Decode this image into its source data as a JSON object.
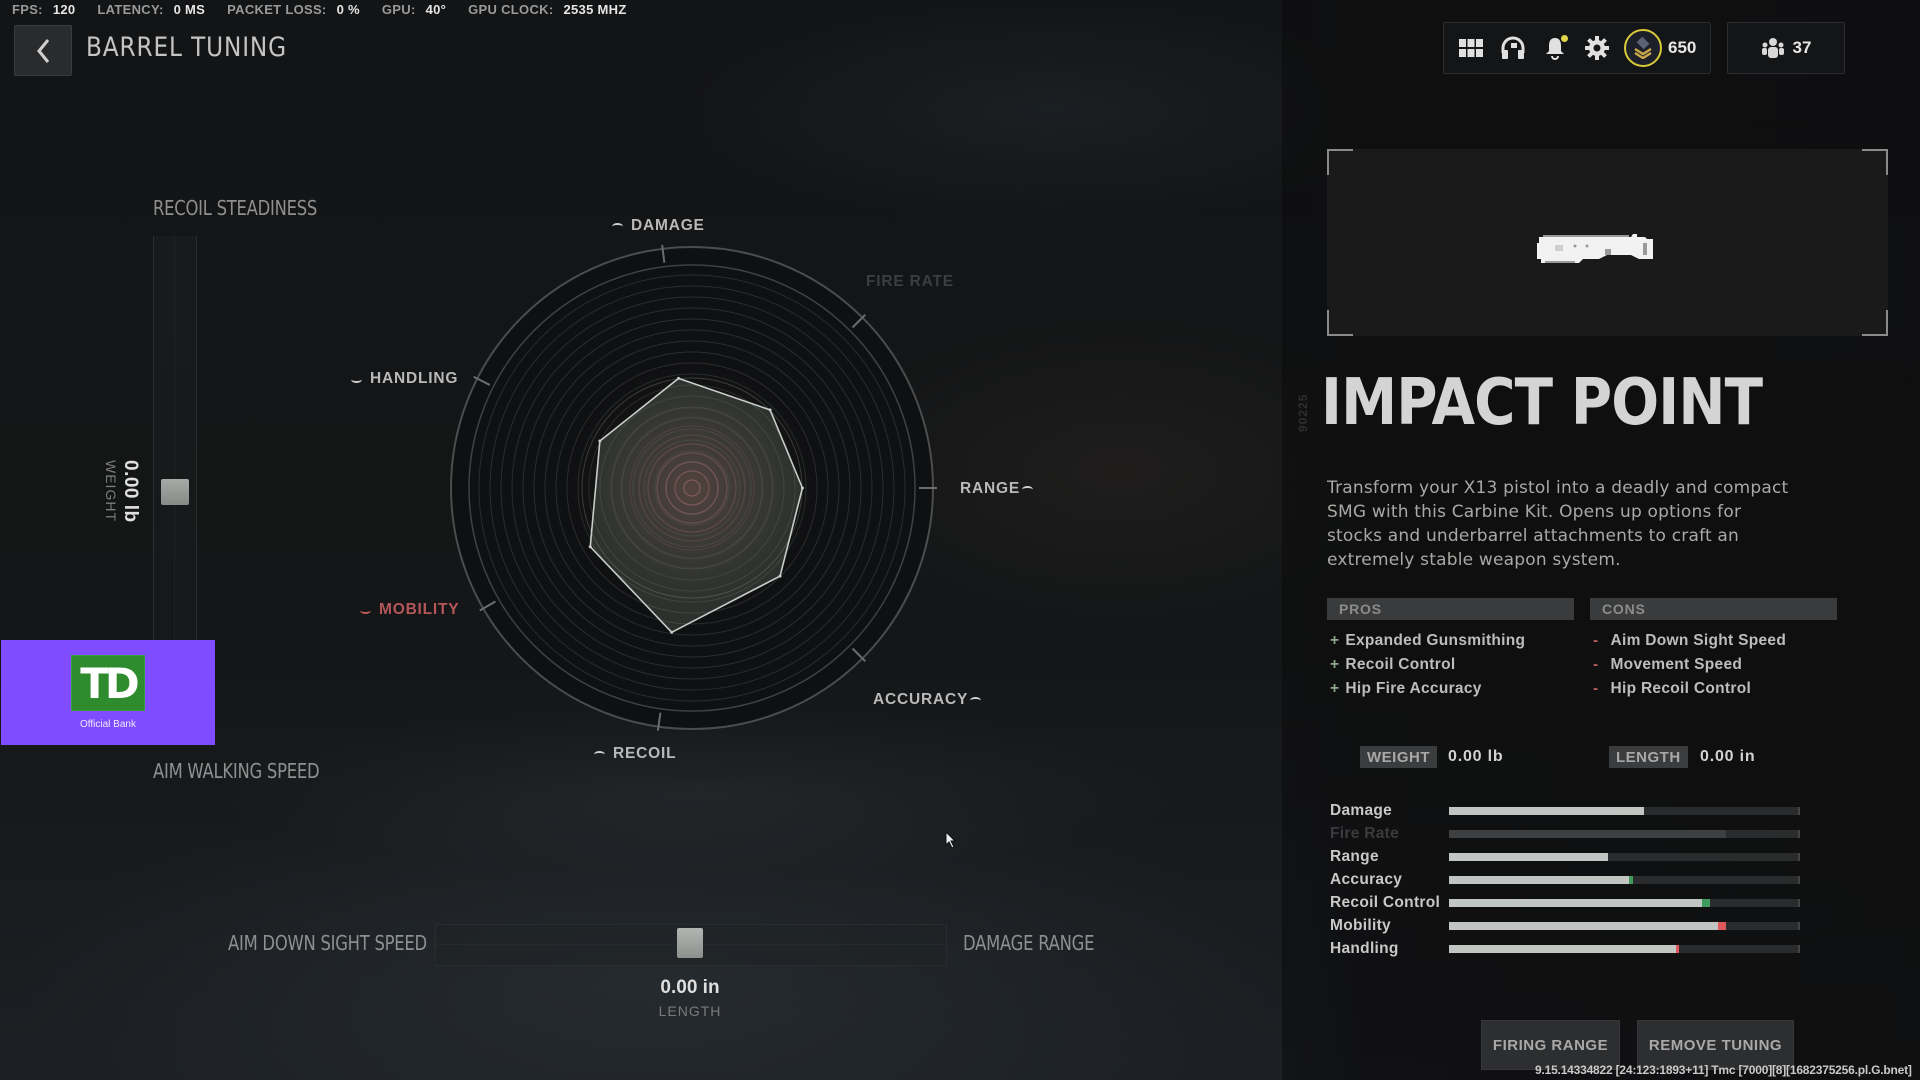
{
  "perf": [
    {
      "label": "FPS:",
      "value": "120"
    },
    {
      "label": "LATENCY:",
      "value": "0 MS"
    },
    {
      "label": "PACKET LOSS:",
      "value": "0 %"
    },
    {
      "label": "GPU:",
      "value": "40°"
    },
    {
      "label": "GPU CLOCK:",
      "value": "2535 MHZ"
    }
  ],
  "header": {
    "title": "BARREL TUNING",
    "icons": [
      "grid-menu-icon",
      "headset-icon",
      "bell-icon",
      "gear-icon"
    ],
    "cod_points": "650",
    "friends_online": "37",
    "notification_dot_color": "#e2d54a",
    "cod_points_badge_color": "#d8c83a"
  },
  "tuning": {
    "vertical_slider": {
      "top_label": "RECOIL STEADINESS",
      "bottom_label": "AIM WALKING SPEED",
      "value": "0.00 lb",
      "value_label": "WEIGHT",
      "position": 0.5
    },
    "horizontal_slider": {
      "left_label": "AIM DOWN SIGHT SPEED",
      "right_label": "DAMAGE RANGE",
      "value": "0.00 in",
      "value_label": "LENGTH",
      "position": 0.5
    }
  },
  "ad": {
    "logo_text": "TD",
    "caption": "Official Bank",
    "bg_color": "#7f4dff",
    "logo_color": "#2e8b2e"
  },
  "chart_data": {
    "type": "radar",
    "title": "",
    "range": [
      0,
      1
    ],
    "axes": [
      {
        "label": "DAMAGE",
        "value": 0.47,
        "state": "normal",
        "indicator": "up"
      },
      {
        "label": "FIRE RATE",
        "value": 0.47,
        "state": "disabled",
        "indicator": "none"
      },
      {
        "label": "RANGE",
        "value": 0.47,
        "state": "normal",
        "indicator": "up"
      },
      {
        "label": "ACCURACY",
        "value": 0.53,
        "state": "normal",
        "indicator": "up"
      },
      {
        "label": "RECOIL",
        "value": 0.62,
        "state": "normal",
        "indicator": "up"
      },
      {
        "label": "MOBILITY",
        "value": 0.5,
        "state": "negative",
        "indicator": "down"
      },
      {
        "label": "HANDLING",
        "value": 0.44,
        "state": "normal",
        "indicator": "down"
      }
    ]
  },
  "attachment": {
    "serial": "90225",
    "name": "IMPACT POINT",
    "description": "Transform your X13 pistol into a deadly and compact SMG with this Carbine Kit. Opens up options for stocks and underbarrel attachments to craft an extremely stable weapon system.",
    "pros_label": "PROS",
    "cons_label": "CONS",
    "pros": [
      "Expanded Gunsmithing",
      "Recoil Control",
      "Hip Fire Accuracy"
    ],
    "cons": [
      "Aim Down Sight Speed",
      "Movement Speed",
      "Hip Recoil Control"
    ],
    "weight_label": "WEIGHT",
    "weight_value": "0.00  lb",
    "length_label": "LENGTH",
    "length_value": "0.00  in"
  },
  "stats": [
    {
      "label": "Damage",
      "value": 0.557,
      "delta": 0,
      "enabled": true
    },
    {
      "label": "Fire Rate",
      "value": 0.79,
      "delta": 0,
      "enabled": false
    },
    {
      "label": "Range",
      "value": 0.452,
      "delta": 0,
      "enabled": true
    },
    {
      "label": "Accuracy",
      "value": 0.514,
      "delta": 0.01,
      "enabled": true
    },
    {
      "label": "Recoil Control",
      "value": 0.722,
      "delta": 0.023,
      "enabled": true
    },
    {
      "label": "Mobility",
      "value": 0.767,
      "delta": -0.022,
      "enabled": true
    },
    {
      "label": "Handling",
      "value": 0.648,
      "delta": -0.007,
      "enabled": true
    }
  ],
  "colors": {
    "positive": "#3f9a5c",
    "negative": "#e0575c"
  },
  "buttons": {
    "firing_range": "FIRING RANGE",
    "remove_tuning": "REMOVE TUNING"
  },
  "build_string": "9.15.14334822 [24:123:1893+11] Tmc [7000][8][1682375256.pl.G.bnet]"
}
